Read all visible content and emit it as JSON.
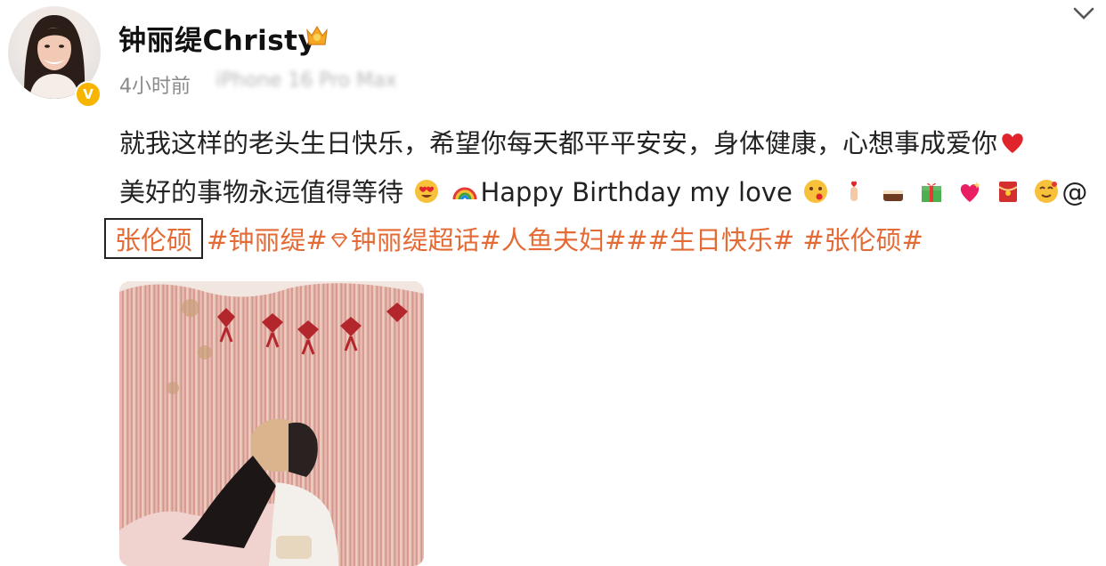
{
  "post": {
    "username": "钟丽缇Christy",
    "time": "4小时前",
    "device": "iPhone 16 Pro Max",
    "text_line1": "就我这样的老头生日快乐，希望你每天都平平安安，身体健康，心想事成爱你",
    "text_line2_a": "美好的事物永远值得等待",
    "text_line2_b": "Happy Birthday my love",
    "at_sign": "@",
    "mention": "张伦硕",
    "tags": {
      "t1": "#钟丽缇#",
      "t2": "钟丽缇超话",
      "t3": "#人鱼夫妇#",
      "t4": "##生日快乐#",
      "t5": "#张伦硕#"
    }
  },
  "colors": {
    "link": "#e46b35",
    "verified_badge": "#f7b500",
    "text": "#222222",
    "meta": "#8a8a8a"
  },
  "icons": [
    "avatar",
    "verified-badge-icon",
    "crown-icon",
    "chevron-down-icon",
    "heart-icon",
    "heart-eyes-icon",
    "rainbow-icon",
    "kiss-face-icon",
    "finger-heart-icon",
    "cake-icon",
    "gift-icon",
    "sparkling-heart-icon",
    "red-envelope-icon",
    "party-face-icon",
    "super-topic-gem-icon"
  ]
}
